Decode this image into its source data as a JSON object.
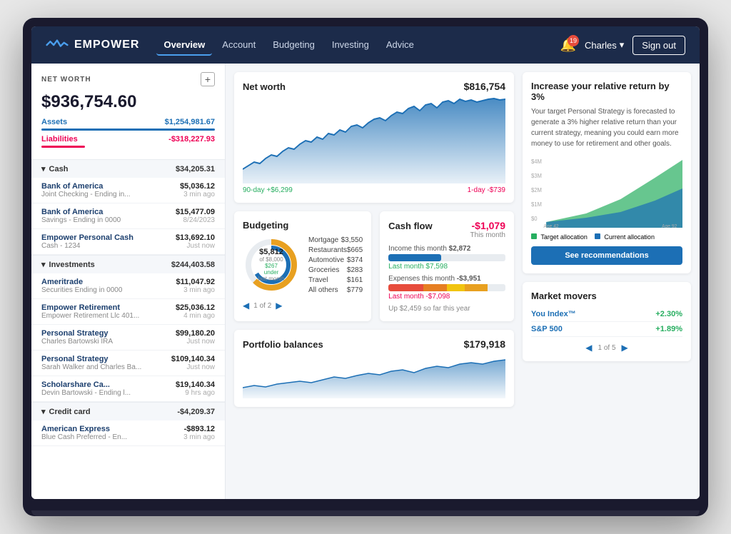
{
  "app": {
    "title": "EMPOWER"
  },
  "navbar": {
    "links": [
      {
        "label": "Overview",
        "active": true
      },
      {
        "label": "Account",
        "active": false
      },
      {
        "label": "Budgeting",
        "active": false
      },
      {
        "label": "Investing",
        "active": false
      },
      {
        "label": "Advice",
        "active": false
      }
    ],
    "bell_count": "19",
    "user": "Charles",
    "signout": "Sign out"
  },
  "sidebar": {
    "net_worth_label": "NET WORTH",
    "net_worth_value": "$936,754.60",
    "assets_label": "Assets",
    "assets_value": "$1,254,981.67",
    "liabilities_label": "Liabilities",
    "liabilities_value": "-$318,227.93",
    "sections": [
      {
        "name": "Cash",
        "total": "$34,205.31",
        "accounts": [
          {
            "name": "Bank of America",
            "value": "$5,036.12",
            "desc": "Joint Checking - Ending in...",
            "time": "3 min ago"
          },
          {
            "name": "Bank of America",
            "value": "$15,477.09",
            "desc": "Savings - Ending in 0000",
            "time": "8/24/2023"
          },
          {
            "name": "Empower Personal Cash",
            "value": "$13,692.10",
            "desc": "Cash - 1234",
            "time": "Just now"
          }
        ]
      },
      {
        "name": "Investments",
        "total": "$244,403.58",
        "accounts": [
          {
            "name": "Ameritrade",
            "value": "$11,047.92",
            "desc": "Securities Ending in 0000",
            "time": "3 min ago"
          },
          {
            "name": "Empower Retirement",
            "value": "$25,036.12",
            "desc": "Empower Retirement Llc 401...",
            "time": "4 min ago"
          },
          {
            "name": "Personal Strategy",
            "value": "$99,180.20",
            "desc": "Charles Bartowski IRA",
            "time": "Just now"
          },
          {
            "name": "Personal Strategy",
            "value": "$109,140.34",
            "desc": "Sarah Walker and Charles Ba...",
            "time": "Just now"
          },
          {
            "name": "Scholarshare Ca...",
            "value": "$19,140.34",
            "desc": "Devin Bartowski - Ending l...",
            "time": "9 hrs ago"
          }
        ]
      },
      {
        "name": "Credit card",
        "total": "-$4,209.37",
        "accounts": [
          {
            "name": "American Express",
            "value": "-$893.12",
            "desc": "Blue Cash Preferred - En...",
            "time": "3 min ago"
          }
        ]
      }
    ]
  },
  "networth": {
    "title": "Net worth",
    "value": "$816,754",
    "period_left": "90-day +$6,299",
    "period_right": "1-day -$739"
  },
  "budgeting": {
    "title": "Budgeting",
    "donut_amount": "$5,812",
    "donut_of": "of $8,000",
    "donut_under": "$267 under",
    "donut_last": "last month",
    "items": [
      {
        "label": "Mortgage",
        "value": "$3,550"
      },
      {
        "label": "Restaurants",
        "value": "$665"
      },
      {
        "label": "Automotive",
        "value": "$374"
      },
      {
        "label": "Groceries",
        "value": "$283"
      },
      {
        "label": "Travel",
        "value": "$161"
      },
      {
        "label": "All others",
        "value": "$779"
      }
    ],
    "page": "1 of 2"
  },
  "cashflow": {
    "title": "Cash flow",
    "value": "-$1,079",
    "subtitle": "This month",
    "income_label": "Income this month",
    "income_value": "$2,872",
    "income_last": "Last month $7,598",
    "expense_label": "Expenses this month",
    "expense_value": "-$3,951",
    "expense_last": "Last month -$7,098",
    "footer": "Up $2,459 so far this year"
  },
  "portfolio": {
    "title": "Portfolio balances",
    "value": "$179,918"
  },
  "recommendation": {
    "title": "Increase your relative return by 3%",
    "body": "Your target Personal Strategy is forecasted to generate a 3% higher relative return than your current strategy, meaning you could earn more money to use for retirement and other goals.",
    "legend_target": "Target allocation",
    "legend_current": "Current allocation",
    "age_left": "Age 42",
    "age_right": "Age 92",
    "y_labels": [
      "$4M",
      "$3M",
      "$2M",
      "$1M",
      "$0"
    ],
    "btn": "See recommendations"
  },
  "movers": {
    "title": "Market movers",
    "items": [
      {
        "name": "You Index™",
        "change": "+2.30%",
        "up": true
      },
      {
        "name": "S&P 500",
        "change": "+1.89%",
        "up": true
      }
    ],
    "page": "1 of 5"
  }
}
